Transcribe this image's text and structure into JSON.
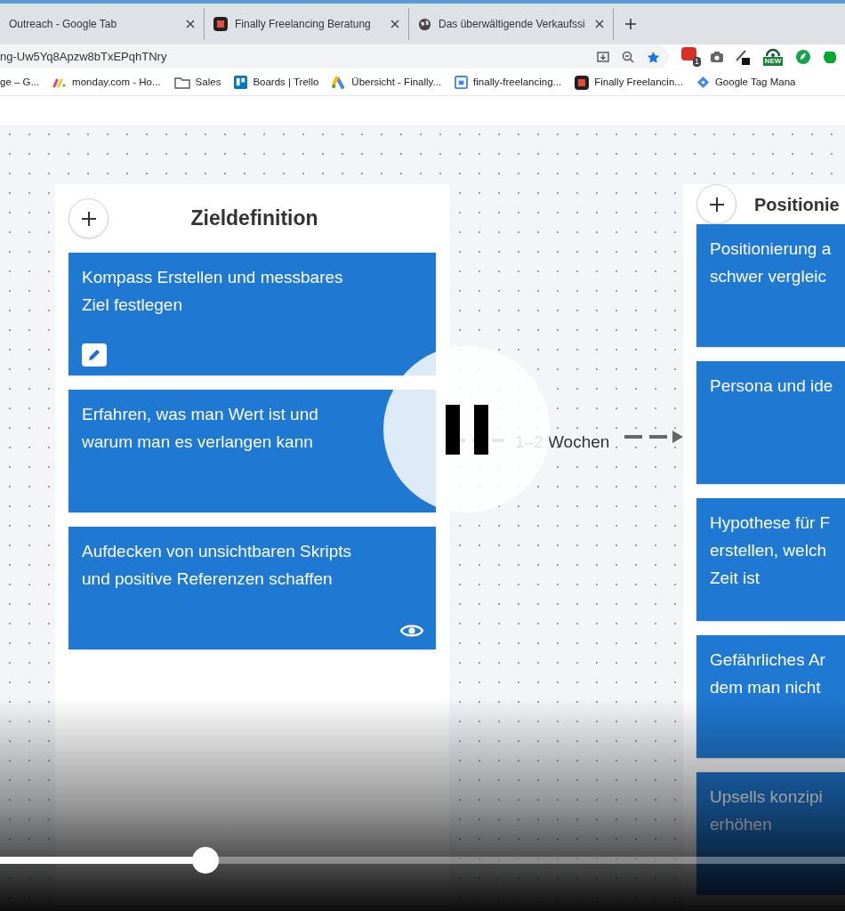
{
  "browser": {
    "tabs": [
      {
        "title": "Outreach - Google Tab",
        "selected": false
      },
      {
        "title": "Finally Freelancing Beratung",
        "selected": false
      },
      {
        "title": "Das überwältigende Verkaufssi",
        "selected": false
      }
    ],
    "url": "ng-Uw5Yq8Apzw8bTxEPqhTNry",
    "extension_badges": [
      "1",
      "NEW"
    ],
    "bookmarks": [
      {
        "label": "ge – G..."
      },
      {
        "label": "monday.com - Ho..."
      },
      {
        "label": "Sales"
      },
      {
        "label": "Boards | Trello"
      },
      {
        "label": "Übersicht - Finally..."
      },
      {
        "label": "finally-freelancing..."
      },
      {
        "label": "Finally Freelancin..."
      },
      {
        "label": "Google Tag Mana"
      }
    ]
  },
  "board": {
    "columns": [
      {
        "title": "Zieldefinition",
        "cards": [
          {
            "text": "Kompass Erstellen und messbares\nZiel festlegen"
          },
          {
            "text": "Erfahren, was man Wert ist und\nwarum man es verlangen kann"
          },
          {
            "text": "Aufdecken von unsichtbaren Skripts\nund positive Referenzen schaffen"
          }
        ]
      },
      {
        "title": "Positionie",
        "cards": [
          {
            "text": "Positionierung a\nschwer vergleic"
          },
          {
            "text": "Persona und ide"
          },
          {
            "text": "Hypothese für F\nerstellen, welch\nZeit ist"
          },
          {
            "text": "Gefährliches Ar\ndem man nicht"
          },
          {
            "text": "Upsells konzipi\nerhöhen"
          }
        ]
      }
    ],
    "connector_label": "1–2 Wochen"
  },
  "player": {
    "progress": {
      "level": 0.243
    }
  }
}
